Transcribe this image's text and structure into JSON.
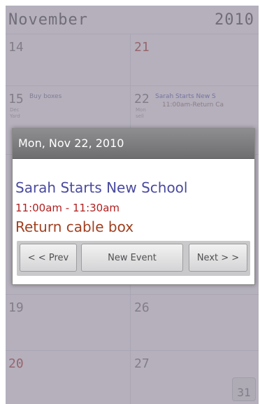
{
  "calendar": {
    "month": "November",
    "year": "2010",
    "today_badge": "31",
    "weeks": [
      {
        "left": {
          "num": "14",
          "red": false,
          "sub": "",
          "event": ""
        },
        "right": {
          "num": "21",
          "red": true,
          "sub": "",
          "event": ""
        }
      },
      {
        "left": {
          "num": "15",
          "red": false,
          "sub": "Dec\nYard",
          "event": "Buy boxes"
        },
        "right": {
          "num": "22",
          "red": false,
          "sub": "Mon\nsell",
          "event": "Sarah Starts New S",
          "event2": "11:00am-Return Ca"
        }
      },
      {
        "left": {
          "num": "",
          "red": false,
          "sub": "",
          "event": ""
        },
        "right": {
          "num": "",
          "red": false,
          "sub": "",
          "event": ""
        }
      },
      {
        "left": {
          "num": "19",
          "red": false,
          "sub": "",
          "event": ""
        },
        "right": {
          "num": "26",
          "red": false,
          "sub": "",
          "event": ""
        }
      },
      {
        "left": {
          "num": "20",
          "red": true,
          "sub": "",
          "event": ""
        },
        "right": {
          "num": "27",
          "red": false,
          "sub": "",
          "event": ""
        }
      }
    ]
  },
  "popup": {
    "date": "Mon, Nov 22, 2010",
    "event_title": "Sarah Starts New School",
    "event_time": "11:00am - 11:30am",
    "event_note": "Return cable box",
    "buttons": {
      "prev": "< < Prev",
      "new_event": "New Event",
      "next": "Next > >"
    }
  },
  "colors": {
    "event_title": "#4a4aa0",
    "event_time": "#b02020",
    "event_note": "#a04020",
    "title_bar": "#7e7e80"
  }
}
